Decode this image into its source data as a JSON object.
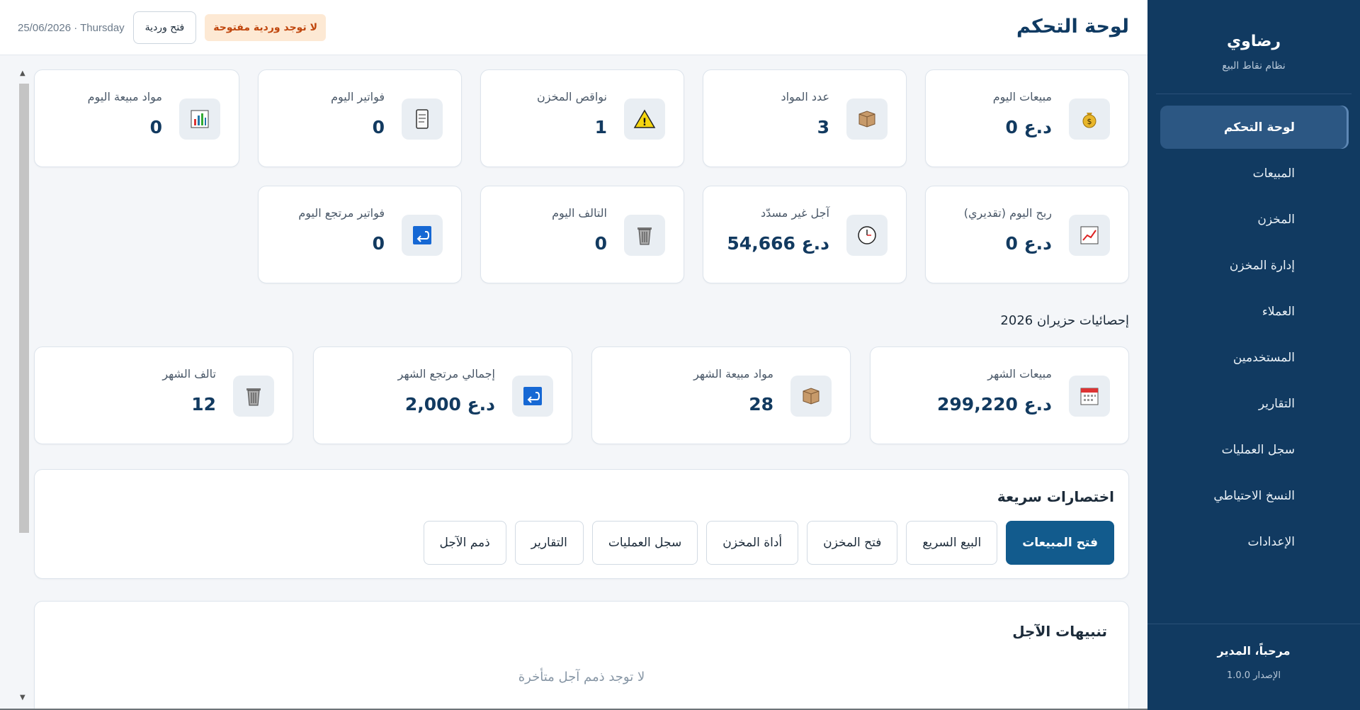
{
  "sidebar": {
    "brand_title": "رضاوي",
    "brand_subtitle": "نظام نقاط البيع",
    "items": [
      {
        "label": "لوحة التحكم",
        "active": true
      },
      {
        "label": "المبيعات"
      },
      {
        "label": "المخزن"
      },
      {
        "label": "إدارة المخزن"
      },
      {
        "label": "العملاء"
      },
      {
        "label": "المستخدمين"
      },
      {
        "label": "التقارير"
      },
      {
        "label": "سجل العمليات"
      },
      {
        "label": "النسخ الاحتياطي"
      },
      {
        "label": "الإعدادات"
      }
    ],
    "welcome": "مرحباً، المدير",
    "version": "الإصدار 1.0.0"
  },
  "header": {
    "title": "لوحة التحكم",
    "no_shift_badge": "لا توجد وردية مفتوحة",
    "open_shift_button": "فتح وردية",
    "date": "25/06/2026 · Thursday"
  },
  "today_stats": [
    {
      "label": "مبيعات اليوم",
      "value": "د.ع 0",
      "icon": "money-bag-icon"
    },
    {
      "label": "عدد المواد",
      "value": "3",
      "icon": "box-icon"
    },
    {
      "label": "نواقص المخزن",
      "value": "1",
      "icon": "warning-icon"
    },
    {
      "label": "فواتير اليوم",
      "value": "0",
      "icon": "receipt-icon"
    },
    {
      "label": "مواد مبيعة اليوم",
      "value": "0",
      "icon": "bar-chart-icon"
    },
    {
      "label": "ربح اليوم (تقديري)",
      "value": "د.ع 0",
      "icon": "trend-chart-icon"
    },
    {
      "label": "آجل غير مسدّد",
      "value": "د.ع 54,666",
      "icon": "clock-icon"
    },
    {
      "label": "التالف اليوم",
      "value": "0",
      "icon": "trash-icon"
    },
    {
      "label": "فواتير مرتجع اليوم",
      "value": "0",
      "icon": "return-icon"
    }
  ],
  "month_section_title": "إحصائيات حزيران 2026",
  "month_stats": [
    {
      "label": "مبيعات الشهر",
      "value": "د.ع 299,220",
      "icon": "calendar-icon"
    },
    {
      "label": "مواد مبيعة الشهر",
      "value": "28",
      "icon": "box-icon"
    },
    {
      "label": "إجمالي مرتجع الشهر",
      "value": "د.ع 2,000",
      "icon": "return-icon"
    },
    {
      "label": "تالف الشهر",
      "value": "12",
      "icon": "trash-icon"
    }
  ],
  "shortcuts": {
    "title": "اختصارات سريعة",
    "buttons": [
      "فتح المبيعات",
      "البيع السريع",
      "فتح المخزن",
      "أداة المخزن",
      "سجل العمليات",
      "التقارير",
      "ذمم الآجل"
    ]
  },
  "alerts": {
    "title": "تنبيهات الآجل",
    "empty_text": "لا توجد ذمم آجل متأخرة"
  },
  "colors": {
    "sidebar_bg": "#113a61",
    "primary": "#125b8d",
    "badge_bg": "#fde9d4",
    "badge_text": "#c0470e"
  }
}
